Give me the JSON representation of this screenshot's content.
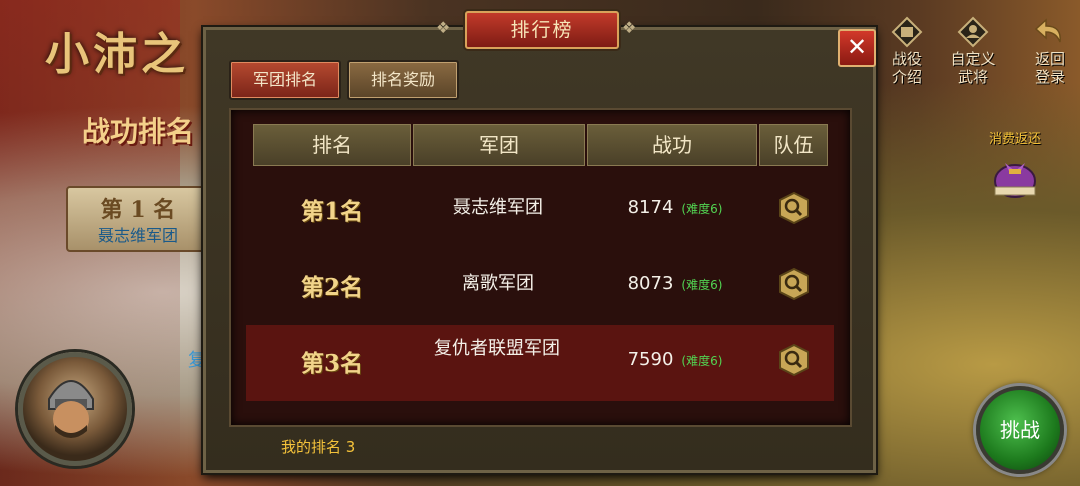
{
  "background": {
    "title": "小沛之",
    "subtitle": "战功排名",
    "top_rank_card": {
      "rank": "第 1 名",
      "name": "聂志维军团"
    },
    "cut_text": "复"
  },
  "side_buttons": [
    {
      "label_line1": "战役",
      "label_line2": "介绍",
      "icon": "battle-book-icon"
    },
    {
      "label_line1": "自定义",
      "label_line2": "武将",
      "icon": "general-custom-icon"
    },
    {
      "label_line1": "返回",
      "label_line2": "登录",
      "icon": "return-arrow-icon"
    }
  ],
  "gift": {
    "label": "消费返还",
    "icon": "gift-pouch-icon"
  },
  "challenge_button": "挑战",
  "dialog": {
    "title": "排行榜",
    "close_icon": "close-icon",
    "tabs": [
      {
        "label": "军团排名",
        "active": true
      },
      {
        "label": "排名奖励",
        "active": false
      }
    ],
    "columns": [
      "排名",
      "军团",
      "战功",
      "队伍"
    ],
    "rows": [
      {
        "rank": "第1名",
        "legion": "聂志维军团",
        "merit": "8174",
        "difficulty": "(难度6)",
        "highlighted": false
      },
      {
        "rank": "第2名",
        "legion": "离歌军团",
        "merit": "8073",
        "difficulty": "(难度6)",
        "highlighted": false
      },
      {
        "rank": "第3名",
        "legion": "复仇者联盟军团",
        "merit": "7590",
        "difficulty": "(难度6)",
        "highlighted": true
      }
    ],
    "my_rank": "我的排名 3"
  },
  "colors": {
    "accent_red": "#b64a30",
    "gold_text": "#f2d48a",
    "difficulty_green": "#52d452",
    "my_rank_yellow": "#f4c23a"
  }
}
